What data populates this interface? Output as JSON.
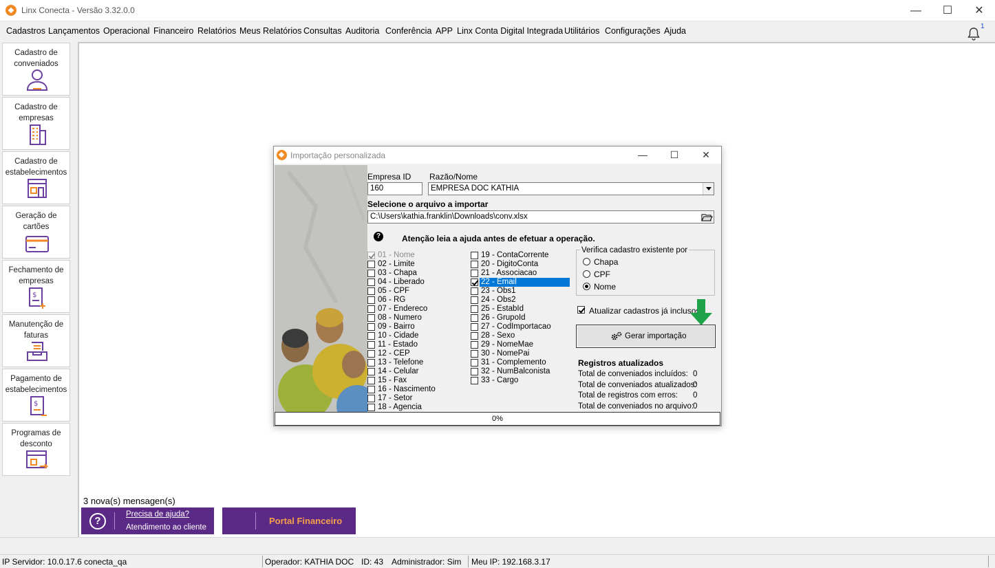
{
  "app": {
    "title": "Linx Conecta - Versão 3.32.0.0"
  },
  "menu": [
    "Cadastros",
    "Lançamentos",
    "Operacional",
    "Financeiro",
    "Relatórios",
    "Meus Relatórios",
    "Consultas",
    "Auditoria",
    "Conferência",
    "APP",
    "Linx Conta Digital Integrada",
    "Utilitários",
    "Configurações",
    "Ajuda"
  ],
  "notifications": {
    "count": "1"
  },
  "sidebar": [
    {
      "label": "Cadastro de conveniados",
      "icon": "user-icon"
    },
    {
      "label": "Cadastro de empresas",
      "icon": "building-icon"
    },
    {
      "label": "Cadastro de estabelecimentos",
      "icon": "store-icon"
    },
    {
      "label": "Geração de cartões",
      "icon": "card-icon"
    },
    {
      "label": "Fechamento de empresas",
      "icon": "invoice-add-icon"
    },
    {
      "label": "Manutenção de faturas",
      "icon": "tray-icon"
    },
    {
      "label": "Pagamento de estabelecimentos",
      "icon": "invoice-pay-icon"
    },
    {
      "label": "Programas de desconto",
      "icon": "discount-icon"
    }
  ],
  "messages": "3 nova(s) mensagen(s)",
  "help": {
    "line1": "Precisa de ajuda?",
    "line2": "Atendimento ao cliente"
  },
  "portal": {
    "label": "Portal Financeiro"
  },
  "status": {
    "server": "IP Servidor: 10.0.17.6 conecta_qa",
    "operator": "Operador: KATHIA DOC",
    "id": "ID: 43",
    "admin": "Administrador: Sim",
    "ip": "Meu IP: 192.168.3.17"
  },
  "dialog": {
    "title": "Importação personalizada",
    "empresa_id_label": "Empresa ID",
    "empresa_id": "160",
    "razao_label": "Razão/Nome",
    "razao": "EMPRESA DOC KATHIA",
    "file_label": "Selecione o arquivo a importar",
    "file_path": "C:\\Users\\kathia.franklin\\Downloads\\conv.xlsx",
    "warning": "Atenção leia a ajuda antes de efetuar a operação.",
    "fields_col1": [
      {
        "label": "01 - Nome",
        "checked": true,
        "disabled": true
      },
      {
        "label": "02 - Limite",
        "checked": false
      },
      {
        "label": "03 - Chapa",
        "checked": false
      },
      {
        "label": "04 - Liberado",
        "checked": false
      },
      {
        "label": "05 - CPF",
        "checked": false
      },
      {
        "label": "06 - RG",
        "checked": false
      },
      {
        "label": "07 - Endereco",
        "checked": false
      },
      {
        "label": "08 - Numero",
        "checked": false
      },
      {
        "label": "09 - Bairro",
        "checked": false
      },
      {
        "label": "10 - Cidade",
        "checked": false
      },
      {
        "label": "11 - Estado",
        "checked": false
      },
      {
        "label": "12 - CEP",
        "checked": false
      },
      {
        "label": "13 - Telefone",
        "checked": false
      },
      {
        "label": "14 - Celular",
        "checked": false
      },
      {
        "label": "15 - Fax",
        "checked": false
      },
      {
        "label": "16 - Nascimento",
        "checked": false
      },
      {
        "label": "17 - Setor",
        "checked": false
      },
      {
        "label": "18 - Agencia",
        "checked": false
      }
    ],
    "fields_col2": [
      {
        "label": "19 - ContaCorrente",
        "checked": false
      },
      {
        "label": "20 - DigitoConta",
        "checked": false
      },
      {
        "label": "21 - Associacao",
        "checked": false
      },
      {
        "label": "22 - Email",
        "checked": true,
        "selected": true
      },
      {
        "label": "23 - Obs1",
        "checked": false
      },
      {
        "label": "24 - Obs2",
        "checked": false
      },
      {
        "label": "25 - EstabId",
        "checked": false
      },
      {
        "label": "26 - GrupoId",
        "checked": false
      },
      {
        "label": "27 - CodImportacao",
        "checked": false
      },
      {
        "label": "28 - Sexo",
        "checked": false
      },
      {
        "label": "29 - NomeMae",
        "checked": false
      },
      {
        "label": "30 - NomePai",
        "checked": false
      },
      {
        "label": "31 - Complemento",
        "checked": false
      },
      {
        "label": "32 - NumBalconista",
        "checked": false
      },
      {
        "label": "33 - Cargo",
        "checked": false
      }
    ],
    "verifica_title": "Verifica cadastro existente por",
    "verifica_options": [
      {
        "label": "Chapa",
        "selected": false
      },
      {
        "label": "CPF",
        "selected": false
      },
      {
        "label": "Nome",
        "selected": true
      }
    ],
    "atualizar_label": "Atualizar cadastros já inclusos.",
    "atualizar_checked": true,
    "gerar_label": "Gerar importação",
    "registros_title": "Registros atualizados",
    "stats": [
      {
        "label": "Total de conveniados incluídos:",
        "value": "0"
      },
      {
        "label": "Total de conveniados atualizados:",
        "value": "0"
      },
      {
        "label": "Total de registros com erros:",
        "value": "0"
      },
      {
        "label": "Total de conveniados no arquivo:",
        "value": "0"
      }
    ],
    "progress": "0%"
  },
  "colors": {
    "brand_purple": "#5b2a86",
    "brand_orange": "#f08a24",
    "selection": "#0078d7",
    "arrow_green": "#1fa34a"
  }
}
